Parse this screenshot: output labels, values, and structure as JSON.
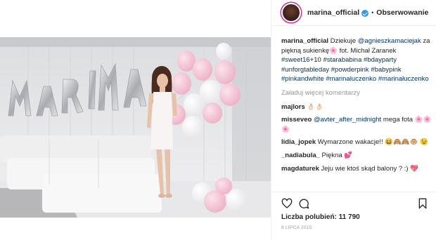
{
  "header": {
    "username": "marina_official",
    "separator": "•",
    "follow_label": "Obserwowanie"
  },
  "caption": {
    "username": "marina_official",
    "t1": " Dziekuje ",
    "mention": "@agnieszkamaciejak",
    "t2": " za piękną sukienkę🌸 fot. Michał Zaranek ",
    "tag1": "#sweet16",
    "t3": "+10 ",
    "tags": "#starababina #bdayparty #unforgtableday #powderpink #babypink #pinkandwhite #marinaluczenko #marinałuczenko"
  },
  "load_more": "Załaduj więcej komentarzy",
  "comments": [
    {
      "user": "majlors",
      "text": " 👌🏻👌🏻"
    },
    {
      "user": "misseveo",
      "mention": "@avter_after_midnight",
      "text": " mega fota 🌸🌸🌸"
    },
    {
      "user": "lidia_jopek",
      "text": " Wymarzone wakacje!! 😆🙈🙈🐵 😉"
    },
    {
      "user": "_nadiabula_",
      "text": " Piękna 💕"
    },
    {
      "user": "magdaturek",
      "text": " Jeju wie ktoś skąd balony ? :) 💖"
    }
  ],
  "likes_label": "Liczba polubień: 11 790",
  "date": "8 LIPCA 2015",
  "colors": {
    "link": "#003569",
    "verified": "#3897f0",
    "muted": "#999999"
  },
  "icons": [
    "heart-icon",
    "comment-icon",
    "bookmark-icon",
    "verified-badge-icon"
  ]
}
